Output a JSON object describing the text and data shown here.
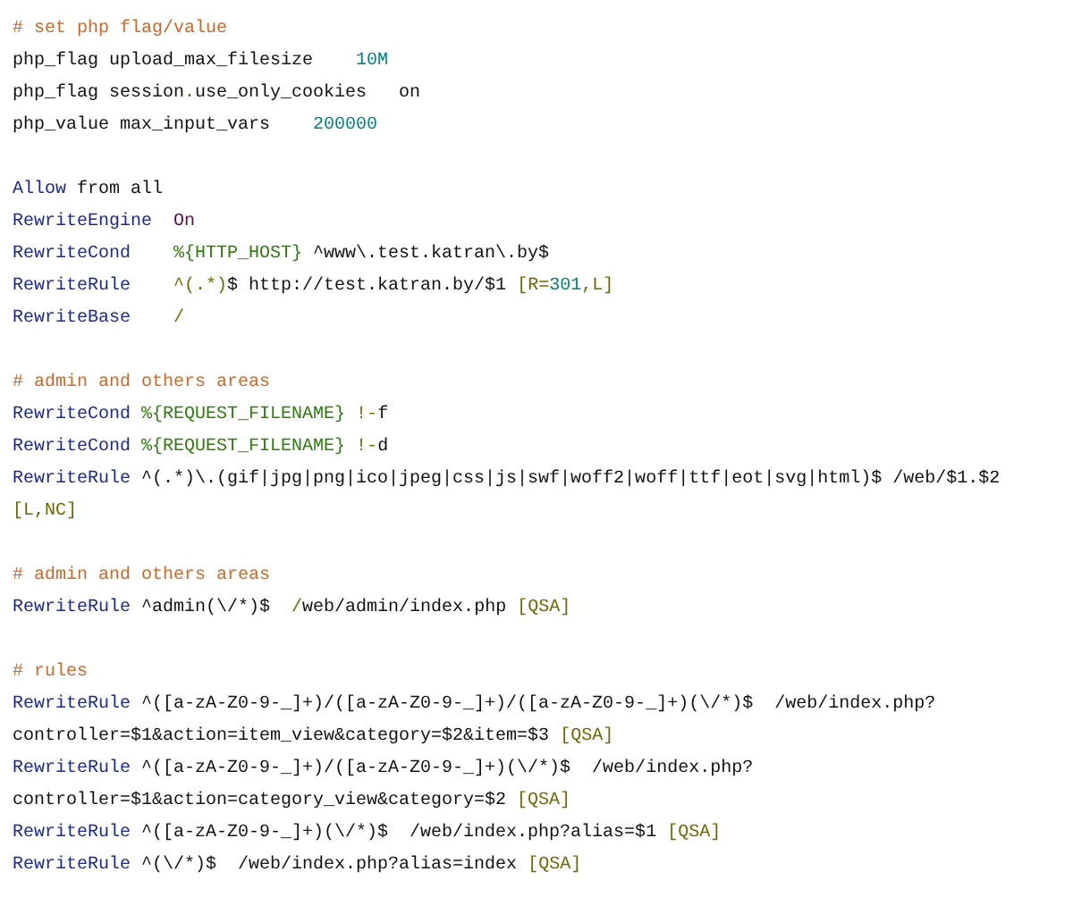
{
  "code_blocks": [
    [
      [
        {
          "kind": "comment",
          "t": "# set php flag/value"
        }
      ],
      [
        {
          "kind": "plain",
          "t": "php_flag upload_max_filesize    "
        },
        {
          "kind": "number",
          "t": "10M"
        }
      ],
      [
        {
          "kind": "plain",
          "t": "php_flag session"
        },
        {
          "kind": "punct",
          "t": "."
        },
        {
          "kind": "plain",
          "t": "use_only_cookies   on"
        }
      ],
      [
        {
          "kind": "plain",
          "t": "php_value max_input_vars    "
        },
        {
          "kind": "number",
          "t": "200000"
        }
      ]
    ],
    [
      [
        {
          "kind": "directive",
          "t": "Allow"
        },
        {
          "kind": "plain",
          "t": " from all"
        }
      ],
      [
        {
          "kind": "directive",
          "t": "RewriteEngine  "
        },
        {
          "kind": "constant",
          "t": "On"
        }
      ],
      [
        {
          "kind": "directive",
          "t": "RewriteCond    "
        },
        {
          "kind": "variable",
          "t": "%{HTTP_HOST}"
        },
        {
          "kind": "plain",
          "t": " ^www\\.test.katran\\.by$"
        }
      ],
      [
        {
          "kind": "directive",
          "t": "RewriteRule    "
        },
        {
          "kind": "punct",
          "t": "^(.*)"
        },
        {
          "kind": "plain",
          "t": "$ http://test.katran.by/$1 "
        },
        {
          "kind": "punct",
          "t": "[R="
        },
        {
          "kind": "number",
          "t": "301"
        },
        {
          "kind": "punct",
          "t": ",L]"
        }
      ],
      [
        {
          "kind": "directive",
          "t": "RewriteBase    "
        },
        {
          "kind": "punct",
          "t": "/"
        }
      ]
    ],
    [
      [
        {
          "kind": "comment",
          "t": "# admin and others areas"
        }
      ],
      [
        {
          "kind": "directive",
          "t": "RewriteCond "
        },
        {
          "kind": "variable",
          "t": "%{REQUEST_FILENAME}"
        },
        {
          "kind": "punct",
          "t": " !-"
        },
        {
          "kind": "plain",
          "t": "f"
        }
      ],
      [
        {
          "kind": "directive",
          "t": "RewriteCond "
        },
        {
          "kind": "variable",
          "t": "%{REQUEST_FILENAME}"
        },
        {
          "kind": "punct",
          "t": " !-"
        },
        {
          "kind": "plain",
          "t": "d"
        }
      ],
      [
        {
          "kind": "directive",
          "t": "RewriteRule"
        },
        {
          "kind": "plain",
          "t": " ^(.*)\\.(gif|jpg|png|ico|jpeg|css|js|swf|woff2|woff|ttf|eot|svg|html)$ /web/$1.$2"
        }
      ],
      [
        {
          "kind": "punct",
          "t": "[L,NC]"
        }
      ]
    ],
    [
      [
        {
          "kind": "comment",
          "t": "# admin and others areas"
        }
      ],
      [
        {
          "kind": "directive",
          "t": "RewriteRule"
        },
        {
          "kind": "plain",
          "t": " ^admin(\\/*)$  "
        },
        {
          "kind": "punct",
          "t": "/"
        },
        {
          "kind": "plain",
          "t": "web/admin/index.php "
        },
        {
          "kind": "punct",
          "t": "[QSA]"
        }
      ]
    ],
    [
      [
        {
          "kind": "comment",
          "t": "# rules"
        }
      ],
      [
        {
          "kind": "directive",
          "t": "RewriteRule"
        },
        {
          "kind": "plain",
          "t": " ^([a-zA-Z0-9-_]+)/([a-zA-Z0-9-_]+)/([a-zA-Z0-9-_]+)(\\/*)$  /web/index.php?"
        }
      ],
      [
        {
          "kind": "plain",
          "t": "controller=$1&action=item_view&category=$2&item=$3 "
        },
        {
          "kind": "punct",
          "t": "[QSA]"
        }
      ],
      [
        {
          "kind": "directive",
          "t": "RewriteRule"
        },
        {
          "kind": "plain",
          "t": " ^([a-zA-Z0-9-_]+)/([a-zA-Z0-9-_]+)(\\/*)$  /web/index.php?"
        }
      ],
      [
        {
          "kind": "plain",
          "t": "controller=$1&action=category_view&category=$2 "
        },
        {
          "kind": "punct",
          "t": "[QSA]"
        }
      ],
      [
        {
          "kind": "directive",
          "t": "RewriteRule"
        },
        {
          "kind": "plain",
          "t": " ^([a-zA-Z0-9-_]+)(\\/*)$  /web/index.php?alias=$1 "
        },
        {
          "kind": "punct",
          "t": "[QSA]"
        }
      ],
      [
        {
          "kind": "directive",
          "t": "RewriteRule"
        },
        {
          "kind": "plain",
          "t": " ^(\\/*)$  /web/index.php?alias=index "
        },
        {
          "kind": "punct",
          "t": "[QSA]"
        }
      ]
    ]
  ]
}
